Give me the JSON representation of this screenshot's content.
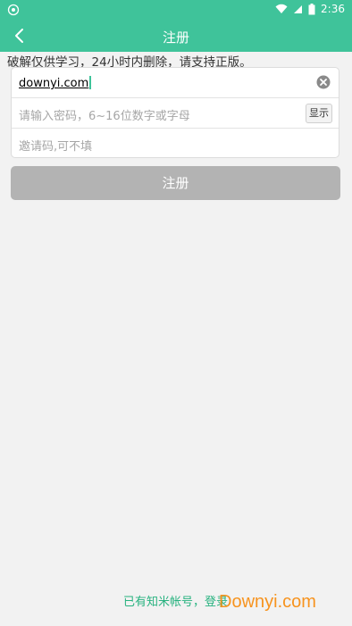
{
  "status_bar": {
    "time": "2:36",
    "icons": [
      "app-notification-icon",
      "wifi-icon",
      "cell-signal-icon",
      "battery-icon"
    ]
  },
  "header": {
    "title": "注册",
    "back_icon": "back-arrow-icon"
  },
  "notice": "破解仅供学习，24小时内删除，请支持正版。",
  "form": {
    "username_value": "downyi.com",
    "password_placeholder": "请输入密码，6~16位数字或字母",
    "show_label": "显示",
    "invite_placeholder": "邀请码,可不填"
  },
  "register_label": "注册",
  "login_link": "已有知米帐号，登录",
  "watermark": "Downyi.com",
  "colors": {
    "accent": "#3fc39a",
    "disabled_button": "#b3b3b3",
    "link": "#27b27f",
    "watermark": "#f7931e"
  }
}
